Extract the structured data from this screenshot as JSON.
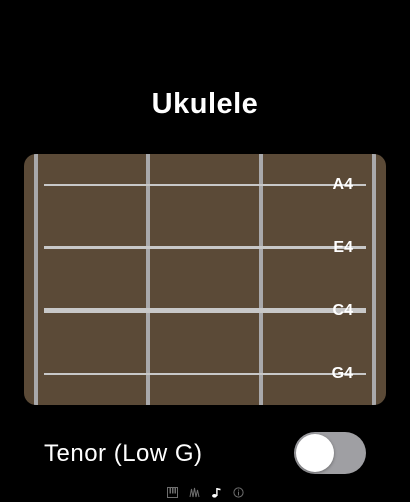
{
  "header": {
    "title": "Ukulele"
  },
  "fretboard": {
    "strings": [
      {
        "note": "A4"
      },
      {
        "note": "E4"
      },
      {
        "note": "C4"
      },
      {
        "note": "G4"
      }
    ]
  },
  "tenor_toggle": {
    "label": "Tenor (Low G)",
    "on": false
  },
  "page_indicator": {
    "pages": [
      "piano-icon",
      "waveform-icon",
      "music-note-icon",
      "info-icon"
    ],
    "current_index": 2
  },
  "colors": {
    "background": "#000000",
    "fretboard_wood": "#5b4a37",
    "fret_wire": "#a9a9ab",
    "string": "#c8c8c8",
    "toggle_off_track": "#9f9fa3",
    "indicator_active": "#ffffff",
    "indicator_inactive": "#6e6e6e"
  }
}
